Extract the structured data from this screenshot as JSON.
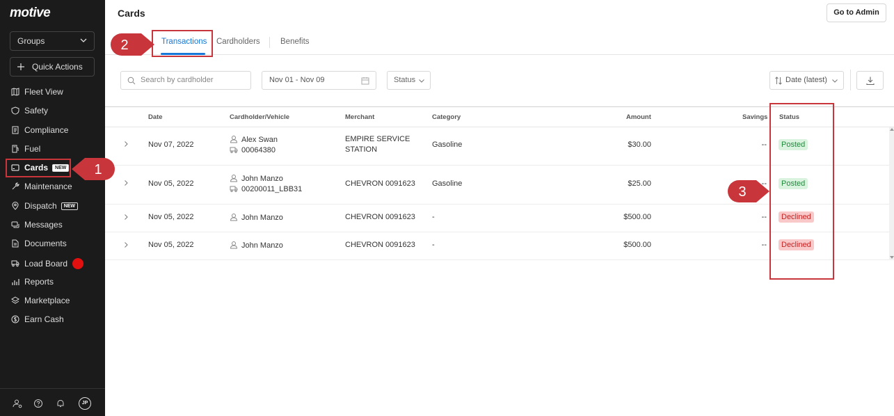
{
  "sidebar": {
    "logo": "motive",
    "groups_label": "Groups",
    "quick_actions_label": "Quick Actions",
    "items": [
      {
        "label": "Fleet View",
        "icon": "map-icon"
      },
      {
        "label": "Safety",
        "icon": "shield-icon"
      },
      {
        "label": "Compliance",
        "icon": "document-icon"
      },
      {
        "label": "Fuel",
        "icon": "fuel-icon"
      },
      {
        "label": "Cards",
        "icon": "card-icon",
        "badge": "NEW",
        "active": true
      },
      {
        "label": "Maintenance",
        "icon": "wrench-icon"
      },
      {
        "label": "Dispatch",
        "icon": "pin-icon",
        "badge": "NEW"
      },
      {
        "label": "Messages",
        "icon": "chat-icon"
      },
      {
        "label": "Documents",
        "icon": "file-icon"
      },
      {
        "label": "Load Board",
        "icon": "truck-icon"
      },
      {
        "label": "Reports",
        "icon": "chart-icon"
      },
      {
        "label": "Marketplace",
        "icon": "layers-icon"
      },
      {
        "label": "Earn Cash",
        "icon": "dollar-icon"
      }
    ],
    "avatar_initials": "JP"
  },
  "header": {
    "title": "Cards",
    "admin_button": "Go to Admin"
  },
  "tabs": [
    {
      "label": "Transactions",
      "active": true
    },
    {
      "label": "Cardholders"
    },
    {
      "label": "Benefits"
    }
  ],
  "filters": {
    "search_placeholder": "Search by cardholder",
    "date_range": "Nov 01 - Nov 09",
    "status_label": "Status",
    "sort_label": "Date (latest)"
  },
  "table": {
    "columns": [
      "Date",
      "Cardholder/Vehicle",
      "Merchant",
      "Category",
      "Amount",
      "Savings",
      "Status"
    ],
    "rows": [
      {
        "date": "Nov 07, 2022",
        "cardholder": "Alex Swan",
        "vehicle": "00064380",
        "merchant": "EMPIRE SERVICE",
        "merchant2": "STATION",
        "category": "Gasoline",
        "amount": "$30.00",
        "savings": "--",
        "status": "Posted"
      },
      {
        "date": "Nov 05, 2022",
        "cardholder": "John Manzo",
        "vehicle": "00200011_LBB31",
        "merchant": "CHEVRON 0091623",
        "merchant2": "",
        "category": "Gasoline",
        "amount": "$25.00",
        "savings": "--",
        "status": "Posted"
      },
      {
        "date": "Nov 05, 2022",
        "cardholder": "John Manzo",
        "vehicle": "",
        "merchant": "CHEVRON 0091623",
        "merchant2": "",
        "category": "-",
        "amount": "$500.00",
        "savings": "--",
        "status": "Declined"
      },
      {
        "date": "Nov 05, 2022",
        "cardholder": "John Manzo",
        "vehicle": "",
        "merchant": "CHEVRON 0091623",
        "merchant2": "",
        "category": "-",
        "amount": "$500.00",
        "savings": "--",
        "status": "Declined"
      }
    ]
  },
  "annotations": [
    "1",
    "2",
    "3"
  ],
  "colors": {
    "sidebar_bg": "#1b1b1b",
    "accent": "#1777d8",
    "callout": "#c8353a",
    "posted_bg": "#d9f3df",
    "declined_bg": "#f9c9c9"
  }
}
